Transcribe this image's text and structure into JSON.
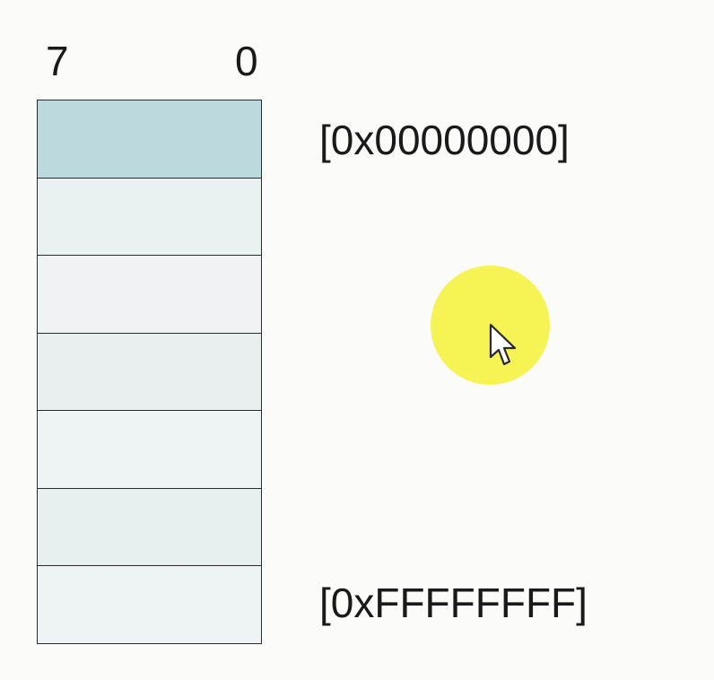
{
  "bit_labels": {
    "high": "7",
    "low": "0"
  },
  "memory": {
    "cells": [
      {
        "fill": "#bcd9dd"
      },
      {
        "fill": "#e9f1f1"
      },
      {
        "fill": "#f0f3f5"
      },
      {
        "fill": "#e8efee"
      },
      {
        "fill": "#eef3f5"
      },
      {
        "fill": "#e8eff1"
      },
      {
        "fill": "#eef3f5"
      }
    ]
  },
  "addresses": {
    "start": "[0x00000000]",
    "end": "[0xFFFFFFFF]"
  },
  "cursor": {
    "icon": "pointer-arrow-icon",
    "highlight_color": "#f6f355"
  }
}
